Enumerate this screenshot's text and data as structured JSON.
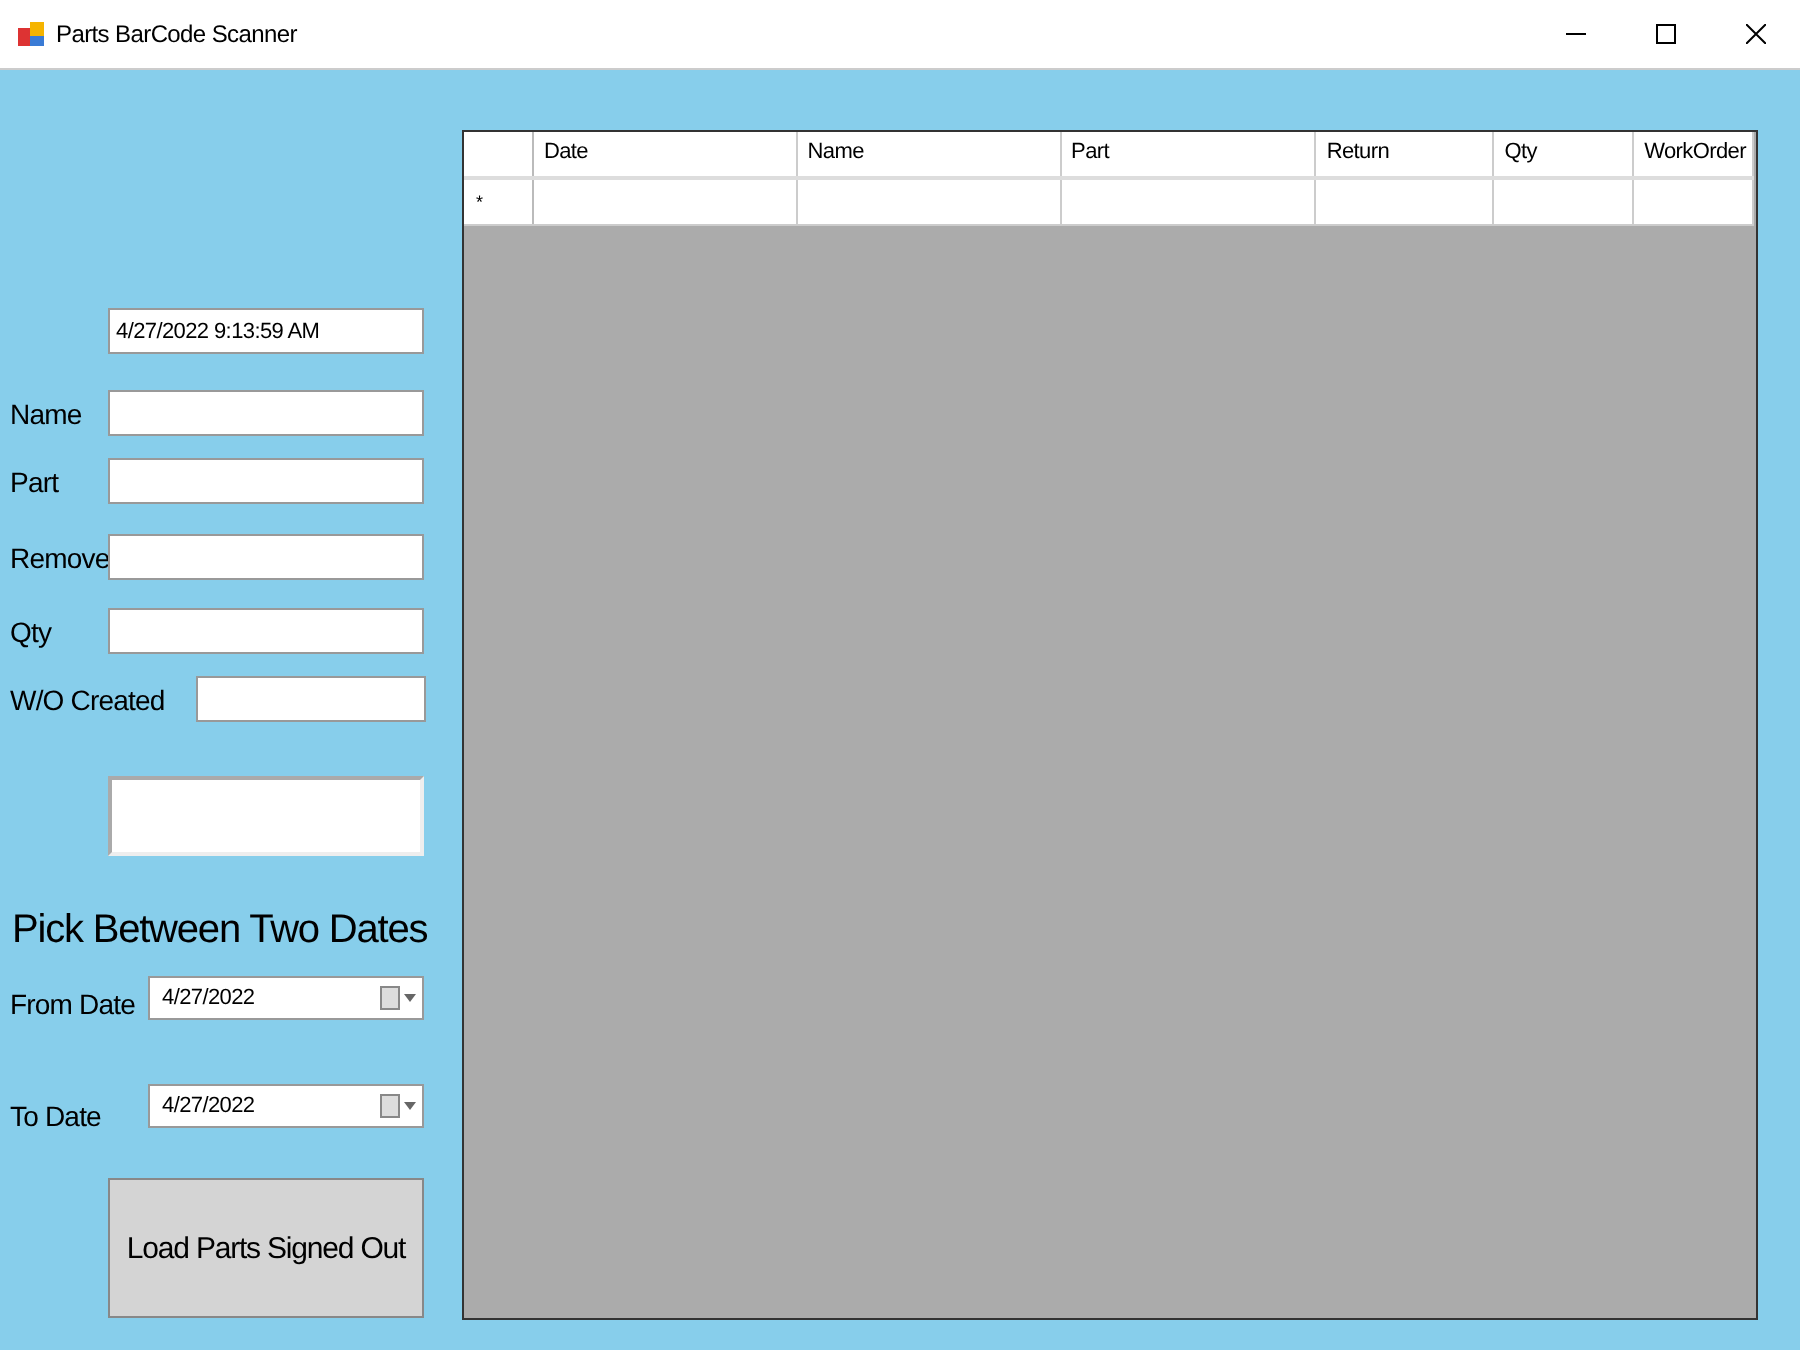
{
  "window": {
    "title": "Parts BarCode Scanner"
  },
  "timestamp": {
    "value": "4/27/2022 9:13:59 AM"
  },
  "fields": [
    {
      "label": "Name",
      "kind": "wide"
    },
    {
      "label": "Part",
      "kind": "wide"
    },
    {
      "label": "Remove",
      "kind": "wide"
    },
    {
      "label": "Qty",
      "kind": "wide"
    },
    {
      "label": "W/O Created",
      "kind": "narrow"
    }
  ],
  "date_range": {
    "heading": "Pick Between Two Dates",
    "pickers": [
      {
        "label": "From Date",
        "value": "4/27/2022"
      },
      {
        "label": "To Date",
        "value": "4/27/2022"
      }
    ]
  },
  "load_button": {
    "label": "Load Parts Signed Out"
  },
  "table": {
    "columns": [
      "Date",
      "Name",
      "Part",
      "Return",
      "Qty",
      "WorkOrder"
    ],
    "new_row_marker": "*"
  }
}
